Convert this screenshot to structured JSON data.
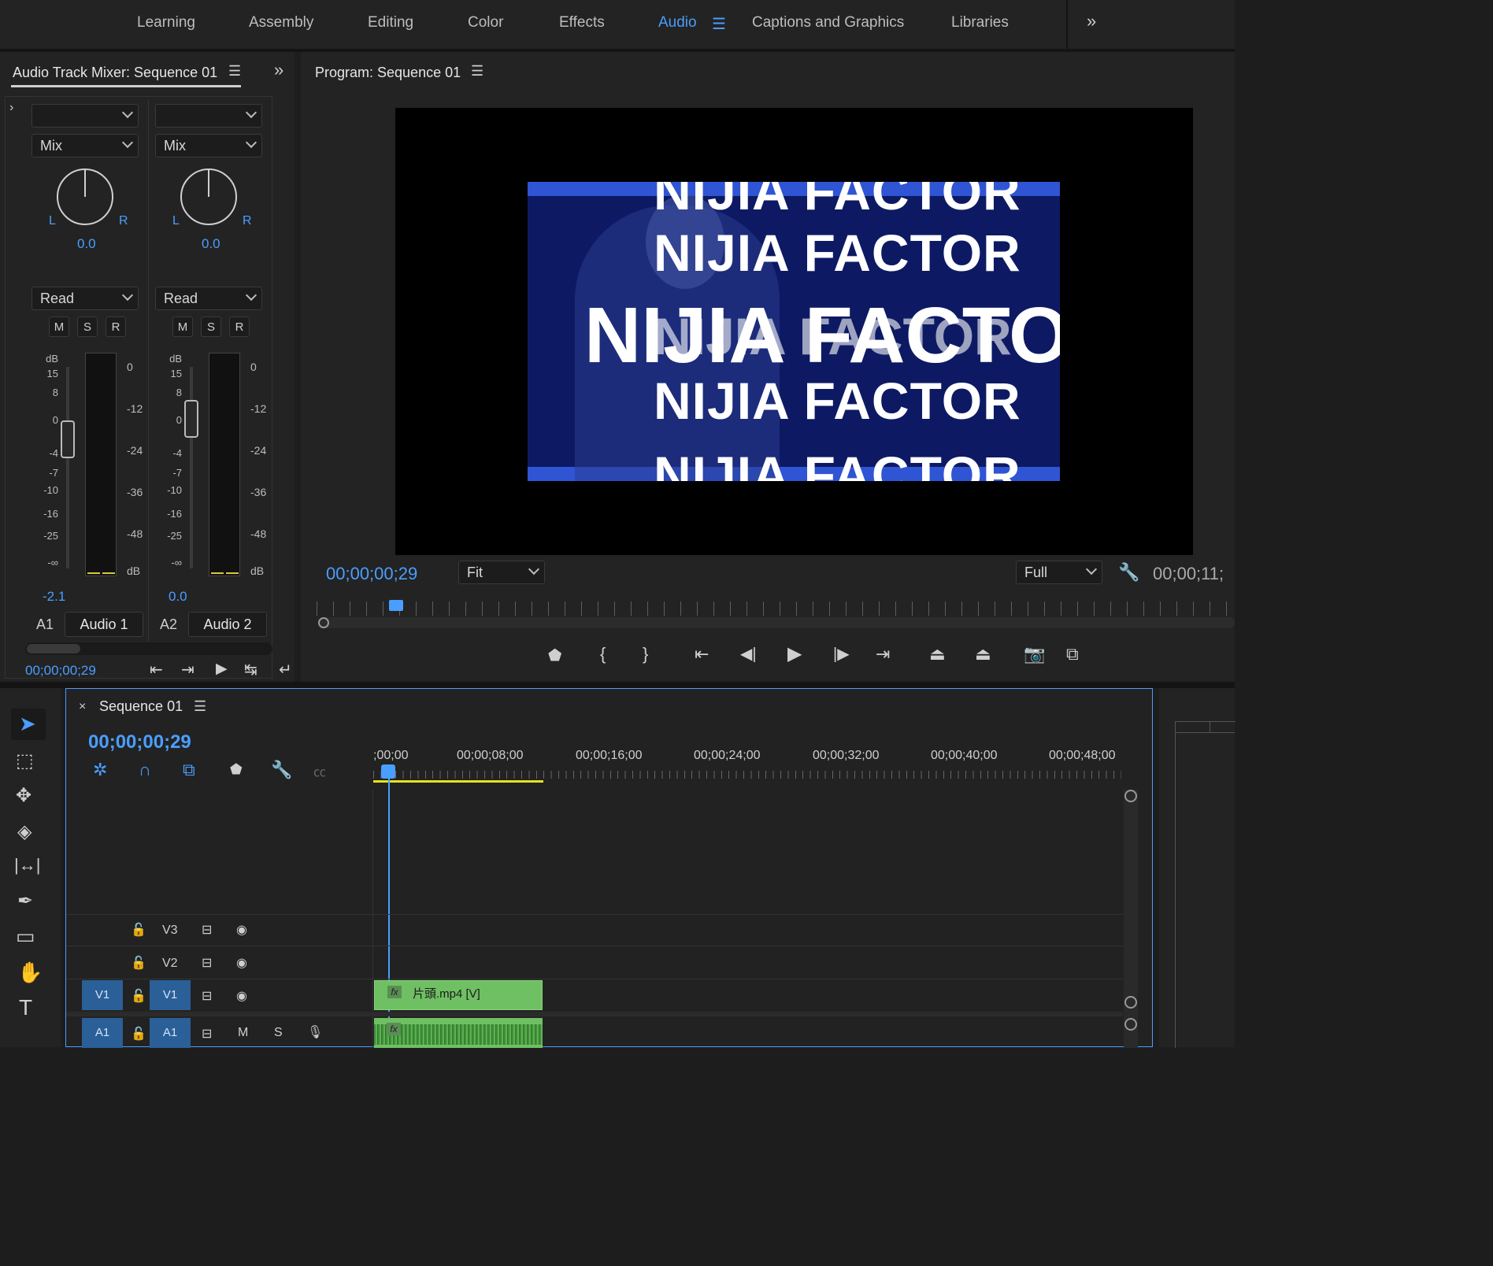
{
  "workspaces": {
    "items": [
      "Learning",
      "Assembly",
      "Editing",
      "Color",
      "Effects",
      "Audio",
      "Captions and Graphics",
      "Libraries"
    ],
    "active": "Audio",
    "more_icon": "double-chevron-right-icon"
  },
  "mixer": {
    "title": "Audio Track Mixer: Sequence 01",
    "channels": [
      {
        "effect": "",
        "send": "Mix",
        "pan_left": "L",
        "pan_right": "R",
        "pan_value": "0.0",
        "automation": "Read",
        "buttons": [
          "M",
          "S",
          "R"
        ],
        "level": "-2.1",
        "track_id": "A1",
        "track_name": "Audio 1"
      },
      {
        "effect": "",
        "send": "Mix",
        "pan_left": "L",
        "pan_right": "R",
        "pan_value": "0.0",
        "automation": "Read",
        "buttons": [
          "M",
          "S",
          "R"
        ],
        "level": "0.0",
        "track_id": "A2",
        "track_name": "Audio 2"
      }
    ],
    "fader_scale": [
      "dB",
      "15",
      "8",
      "0",
      "-4",
      "-7",
      "-10",
      "-16",
      "-25",
      "-∞"
    ],
    "meter_scale": [
      "0",
      "-12",
      "-24",
      "-36",
      "-48",
      "dB"
    ],
    "timecode": "00;00;00;29"
  },
  "program": {
    "title": "Program: Sequence 01",
    "timecode": "00;00;00;29",
    "zoom": "Fit",
    "resolution": "Full",
    "duration": "00;00;11;",
    "frame_text": [
      "NIJIA FACTOR",
      "NIJIA FACTOR",
      "NIJIA FACTOR",
      "NIJIA FACTOR",
      "NIJIA FACTOR",
      "NIJIA FACTOR"
    ],
    "accent": "#2f55d4"
  },
  "timeline": {
    "title": "Sequence 01",
    "timecode": "00;00;00;29",
    "ruler": [
      ";00;00",
      "00;00;08;00",
      "00;00;16;00",
      "00;00;24;00",
      "00;00;32;00",
      "00;00;40;00",
      "00;00;48;00"
    ],
    "tracks": [
      {
        "src": "",
        "id": "V3"
      },
      {
        "src": "",
        "id": "V2"
      },
      {
        "src": "V1",
        "id": "V1"
      },
      {
        "src": "A1",
        "id": "A1",
        "buttons": [
          "M",
          "S"
        ]
      }
    ],
    "video_clip": "片頭.mp4 [V]",
    "clip_badge": "fx",
    "clip_color": "#6fbf63"
  }
}
